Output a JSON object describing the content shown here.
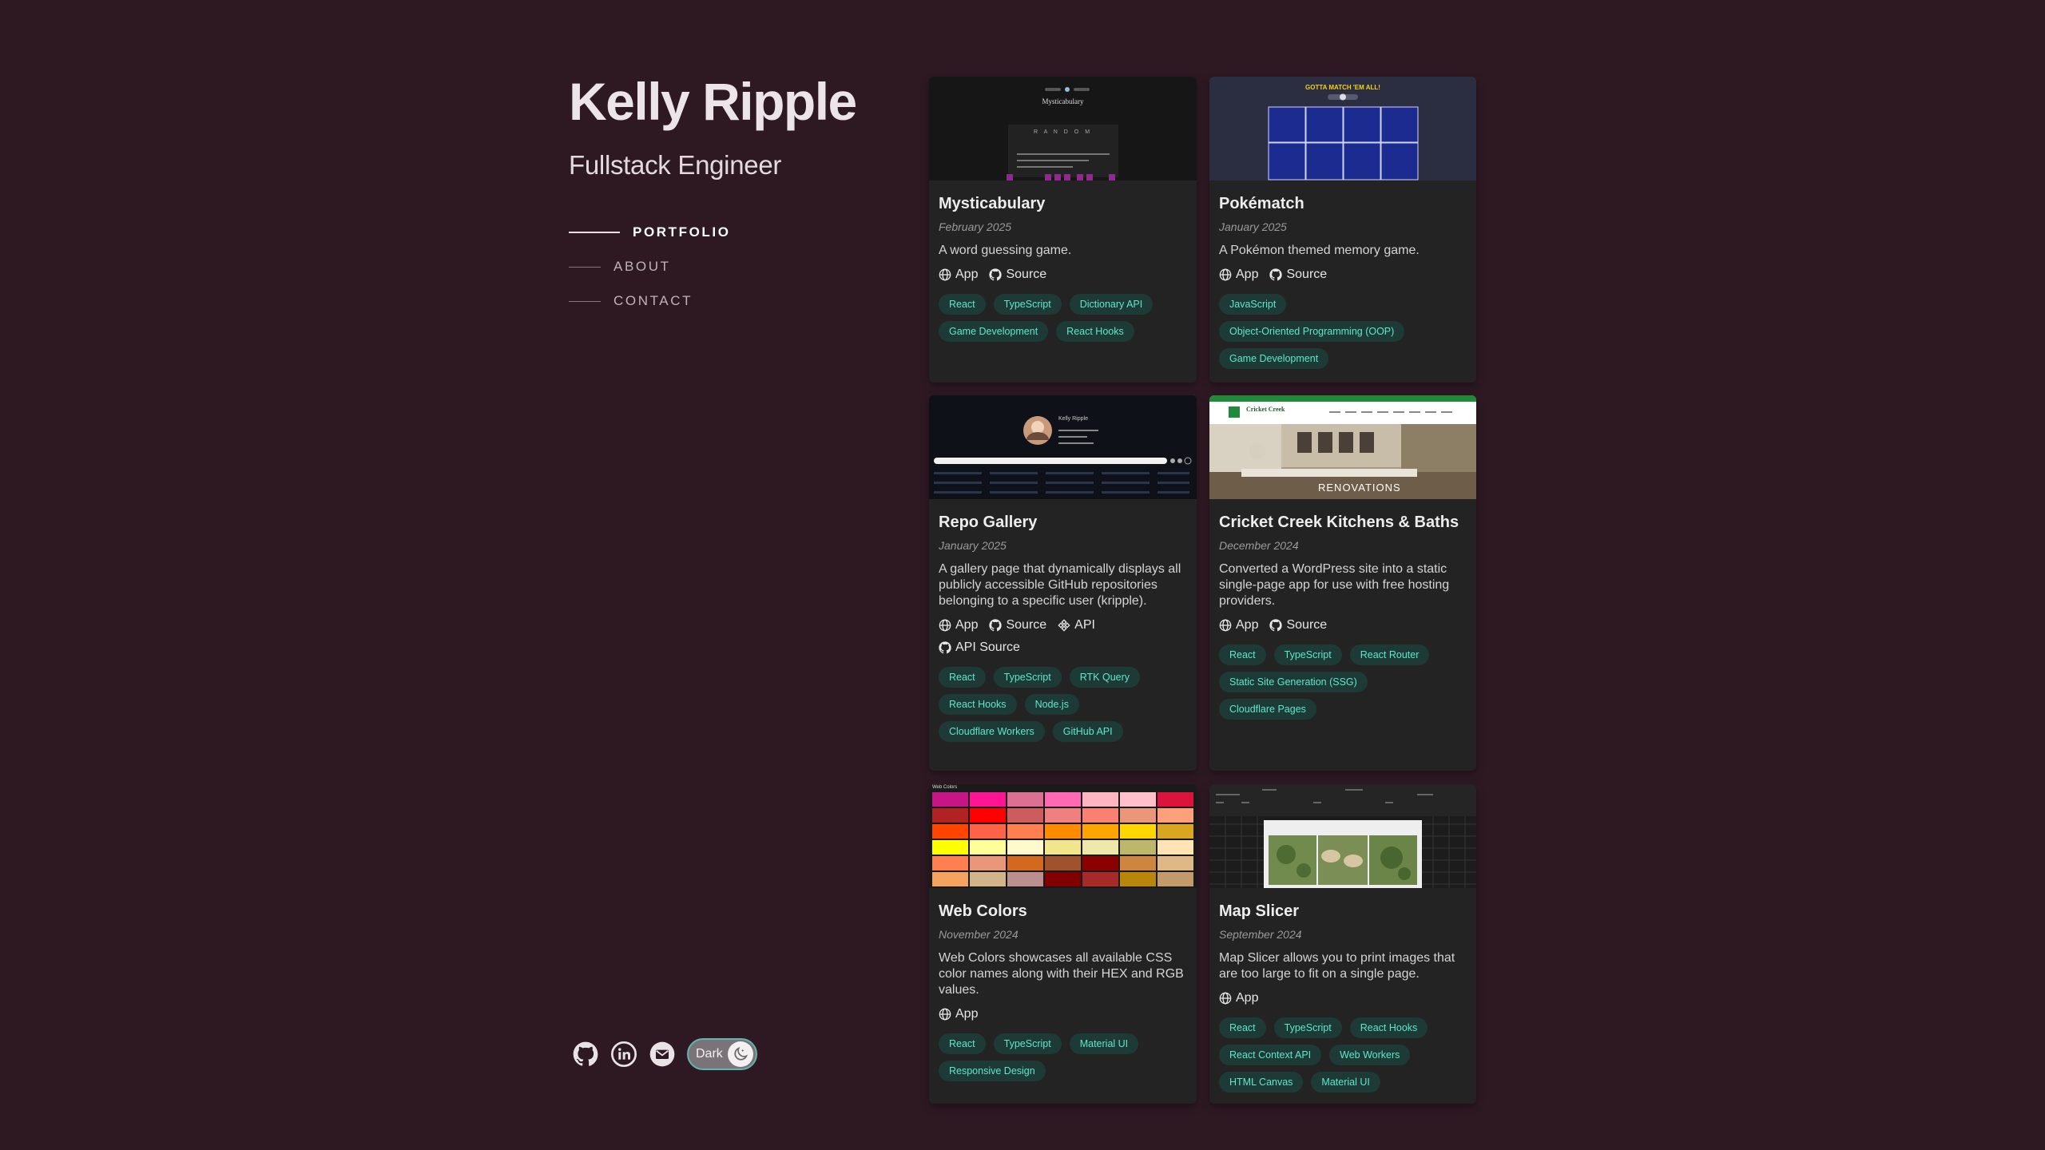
{
  "profile": {
    "name": "Kelly Ripple",
    "title": "Fullstack Engineer"
  },
  "nav": [
    {
      "label": "PORTFOLIO",
      "active": true
    },
    {
      "label": "ABOUT",
      "active": false
    },
    {
      "label": "CONTACT",
      "active": false
    }
  ],
  "social": {
    "icons": [
      "github-icon",
      "linkedin-icon",
      "email-icon"
    ],
    "theme_toggle_label": "Dark"
  },
  "projects": [
    {
      "title": "Mysticabulary",
      "date": "February 2025",
      "description": "A word guessing game.",
      "links": [
        "App",
        "Source"
      ],
      "tags": [
        "React",
        "TypeScript",
        "Dictionary API",
        "Game Development",
        "React Hooks"
      ],
      "thumb": {
        "app_title": "Mysticabulary",
        "letters": "R A N D O M"
      }
    },
    {
      "title": "Pokématch",
      "date": "January 2025",
      "description": "A Pokémon themed memory game.",
      "links": [
        "App",
        "Source"
      ],
      "tags": [
        "JavaScript",
        "Object-Oriented Programming (OOP)",
        "Game Development"
      ],
      "thumb": {
        "banner": "GOTTA MATCH 'EM ALL!"
      }
    },
    {
      "title": "Repo Gallery",
      "date": "January 2025",
      "description": "A gallery page that dynamically displays all publicly accessible GitHub repositories belonging to a specific user (kripple).",
      "links": [
        "App",
        "Source",
        "API",
        "API Source"
      ],
      "tags": [
        "React",
        "TypeScript",
        "RTK Query",
        "React Hooks",
        "Node.js",
        "Cloudflare Workers",
        "GitHub API"
      ],
      "thumb": {
        "user": "Kelly Ripple"
      }
    },
    {
      "title": "Cricket Creek Kitchens & Baths",
      "date": "December 2024",
      "description": "Converted a WordPress site into a static single-page app for use with free hosting providers.",
      "links": [
        "App",
        "Source"
      ],
      "tags": [
        "React",
        "TypeScript",
        "React Router",
        "Static Site Generation (SSG)",
        "Cloudflare Pages"
      ],
      "thumb": {
        "brand": "Cricket Creek",
        "overlay": "RENOVATIONS"
      }
    },
    {
      "title": "Web Colors",
      "date": "November 2024",
      "description": "Web Colors showcases all available CSS color names along with their HEX and RGB values.",
      "links": [
        "App"
      ],
      "tags": [
        "React",
        "TypeScript",
        "Material UI",
        "Responsive Design"
      ],
      "thumb": {
        "app_title": "Web Colors"
      }
    },
    {
      "title": "Map Slicer",
      "date": "September 2024",
      "description": "Map Slicer allows you to print images that are too large to fit on a single page.",
      "links": [
        "App"
      ],
      "tags": [
        "React",
        "TypeScript",
        "React Hooks",
        "React Context API",
        "Web Workers",
        "HTML Canvas",
        "Material UI"
      ],
      "thumb": {}
    }
  ],
  "colors": {
    "background": "#2e1923",
    "card": "#232323",
    "tag_text": "#5ee8c8",
    "tag_bg": "#1d3a37",
    "toggle_border": "#5fb5b0"
  }
}
